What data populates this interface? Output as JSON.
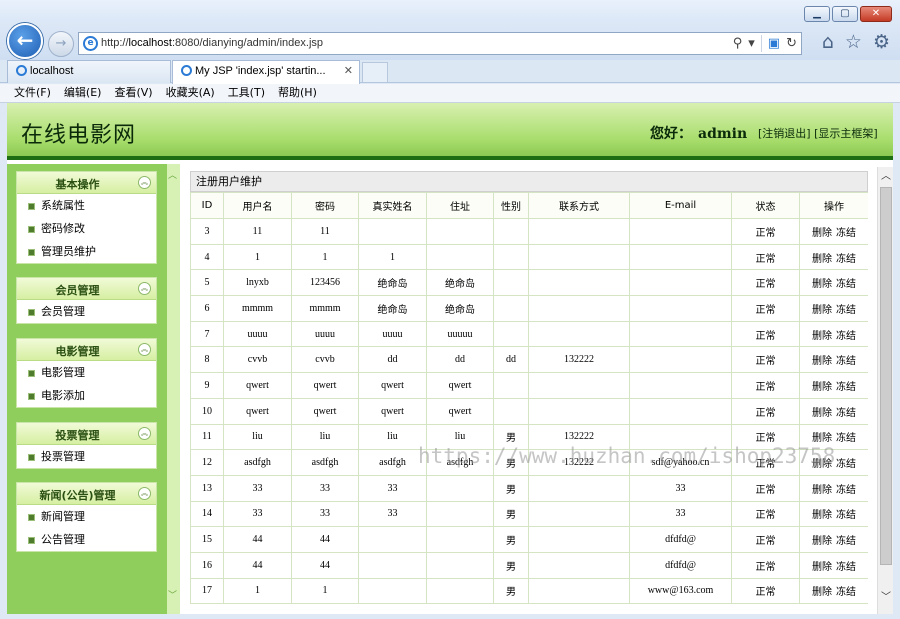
{
  "browser": {
    "url_prefix": "http://",
    "url_host": "localhost",
    "url_rest": ":8080/dianying/admin/index.jsp",
    "tabs": [
      {
        "label": "localhost"
      },
      {
        "label": "My JSP 'index.jsp' startin..."
      }
    ],
    "menu": [
      "文件(F)",
      "编辑(E)",
      "查看(V)",
      "收藏夹(A)",
      "工具(T)",
      "帮助(H)"
    ]
  },
  "header": {
    "site_title": "在线电影网",
    "greeting": "您好：",
    "username": "admin",
    "logout_link": "[注销退出]",
    "main_frame_link": "[显示主框架]"
  },
  "sidebar": [
    {
      "title": "基本操作",
      "items": [
        "系统属性",
        "密码修改",
        "管理员维护"
      ]
    },
    {
      "title": "会员管理",
      "items": [
        "会员管理"
      ]
    },
    {
      "title": "电影管理",
      "items": [
        "电影管理",
        "电影添加"
      ]
    },
    {
      "title": "投票管理",
      "items": [
        "投票管理"
      ]
    },
    {
      "title": "新闻(公告)管理",
      "items": [
        "新闻管理",
        "公告管理"
      ]
    }
  ],
  "panel_title": "注册用户维护",
  "table": {
    "columns": [
      "ID",
      "用户名",
      "密码",
      "真实姓名",
      "住址",
      "性别",
      "联系方式",
      "E-mail",
      "状态",
      "操作"
    ],
    "delete_label": "删除",
    "freeze_label": "冻结",
    "rows": [
      [
        "3",
        "11",
        "11",
        "",
        "",
        "",
        "",
        "",
        "正常"
      ],
      [
        "4",
        "1",
        "1",
        "1",
        "",
        "",
        "",
        "",
        "正常"
      ],
      [
        "5",
        "lnyxb",
        "123456",
        "绝命岛",
        "绝命岛",
        "",
        "",
        "",
        "正常"
      ],
      [
        "6",
        "mmmm",
        "mmmm",
        "绝命岛",
        "绝命岛",
        "",
        "",
        "",
        "正常"
      ],
      [
        "7",
        "uuuu",
        "uuuu",
        "uuuu",
        "uuuuu",
        "",
        "",
        "",
        "正常"
      ],
      [
        "8",
        "cvvb",
        "cvvb",
        "dd",
        "dd",
        "dd",
        "132222",
        "",
        "正常"
      ],
      [
        "9",
        "qwert",
        "qwert",
        "qwert",
        "qwert",
        "",
        "",
        "",
        "正常"
      ],
      [
        "10",
        "qwert",
        "qwert",
        "qwert",
        "qwert",
        "",
        "",
        "",
        "正常"
      ],
      [
        "11",
        "liu",
        "liu",
        "liu",
        "liu",
        "男",
        "132222",
        "",
        "正常"
      ],
      [
        "12",
        "asdfgh",
        "asdfgh",
        "asdfgh",
        "asdfgh",
        "男",
        "132222",
        "sdf@yahoo.cn",
        "正常"
      ],
      [
        "13",
        "33",
        "33",
        "33",
        "",
        "男",
        "",
        "33",
        "正常"
      ],
      [
        "14",
        "33",
        "33",
        "33",
        "",
        "男",
        "",
        "33",
        "正常"
      ],
      [
        "15",
        "44",
        "44",
        "",
        "",
        "男",
        "",
        "dfdfd@",
        "正常"
      ],
      [
        "16",
        "44",
        "44",
        "",
        "",
        "男",
        "",
        "dfdfd@",
        "正常"
      ],
      [
        "17",
        "1",
        "1",
        "",
        "",
        "男",
        "",
        "www@163.com",
        "正常"
      ]
    ]
  },
  "watermark": "https://www.huzhan.com/ishop23758"
}
